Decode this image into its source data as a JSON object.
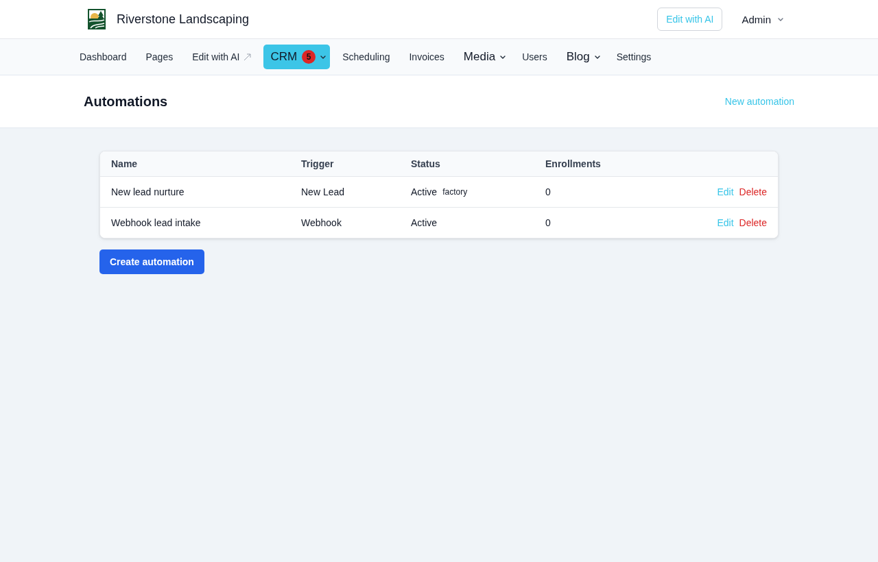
{
  "header": {
    "brand": "Riverstone Landscaping",
    "edit_button": "Edit with AI",
    "user_menu": "Admin"
  },
  "nav": [
    {
      "label": "Dashboard",
      "kind": "link",
      "selected": false
    },
    {
      "label": "Pages",
      "kind": "link",
      "selected": false
    },
    {
      "label": "Edit with AI",
      "kind": "external",
      "selected": false
    },
    {
      "label": "CRM",
      "kind": "dropdown",
      "selected": true,
      "badge": "5"
    },
    {
      "label": "Scheduling",
      "kind": "link",
      "selected": false
    },
    {
      "label": "Invoices",
      "kind": "link",
      "selected": false
    },
    {
      "label": "Media",
      "kind": "dropdown",
      "selected": false
    },
    {
      "label": "Users",
      "kind": "link",
      "selected": false
    },
    {
      "label": "Blog",
      "kind": "dropdown",
      "selected": false
    },
    {
      "label": "Settings",
      "kind": "link",
      "selected": false
    }
  ],
  "page": {
    "title": "Automations",
    "action": "New automation"
  },
  "table": {
    "columns": [
      "Name",
      "Trigger",
      "Status",
      "Enrollments"
    ],
    "rows": [
      {
        "name": "New lead nurture",
        "trigger": "New Lead",
        "status": "Active",
        "tag": "factory",
        "enrollments": "0",
        "actions": [
          {
            "label": "Edit",
            "kind": "edit"
          },
          {
            "label": "Delete",
            "kind": "delete"
          }
        ]
      },
      {
        "name": "Webhook lead intake",
        "trigger": "Webhook",
        "status": "Active",
        "enrollments": "0",
        "actions": [
          {
            "label": "Edit",
            "kind": "edit"
          },
          {
            "label": "Delete",
            "kind": "delete"
          }
        ]
      }
    ]
  },
  "create_button": "Create automation"
}
